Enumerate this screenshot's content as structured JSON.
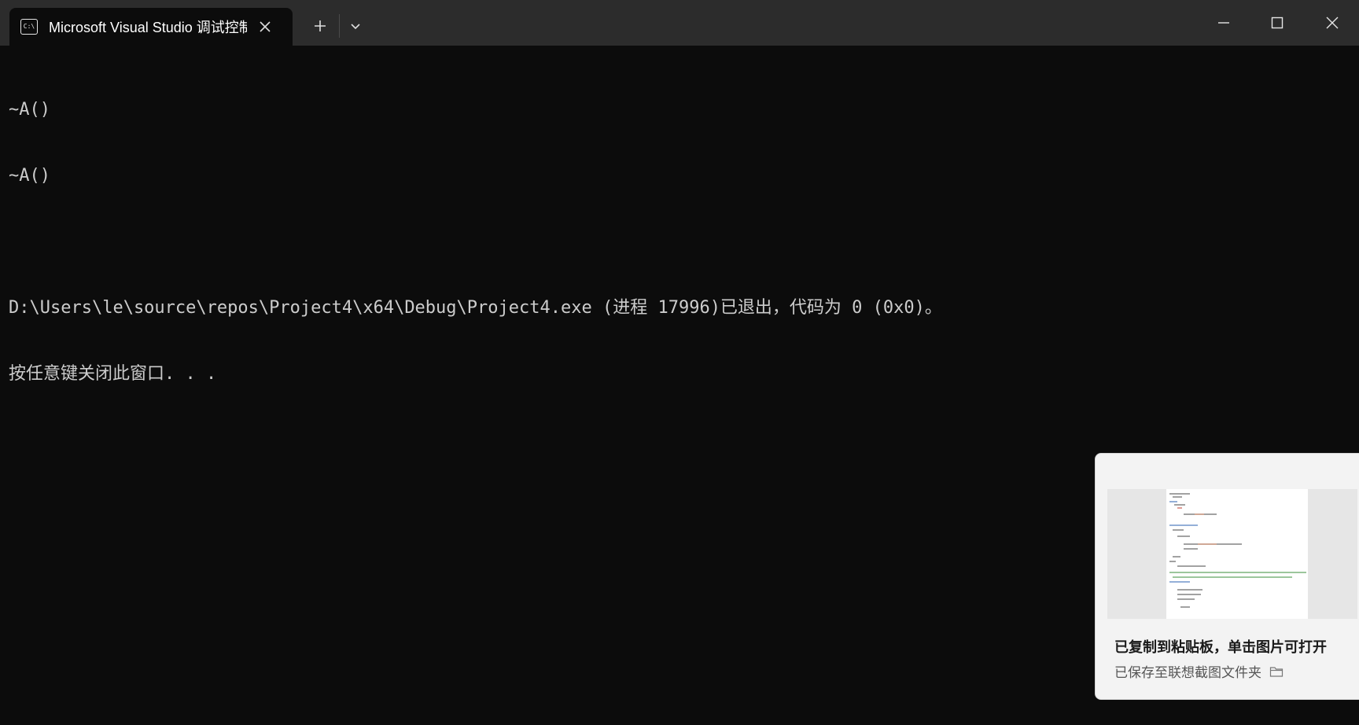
{
  "window": {
    "tab_title": "Microsoft Visual Studio 调试控制台",
    "tab_icon_text": "C:\\",
    "colors": {
      "titlebar": "#2c2c2c",
      "terminal_bg": "#0c0c0c",
      "terminal_fg": "#cccccc",
      "toast_bg": "#f3f3f3"
    }
  },
  "terminal": {
    "lines": [
      "~A()",
      "~A()",
      "",
      "D:\\Users\\le\\source\\repos\\Project4\\x64\\Debug\\Project4.exe (进程 17996)已退出，代码为 0 (0x0)。",
      "按任意键关闭此窗口. . ."
    ]
  },
  "toast": {
    "title": "已复制到粘贴板，单击图片可打开",
    "subtitle": "已保存至联想截图文件夹"
  }
}
